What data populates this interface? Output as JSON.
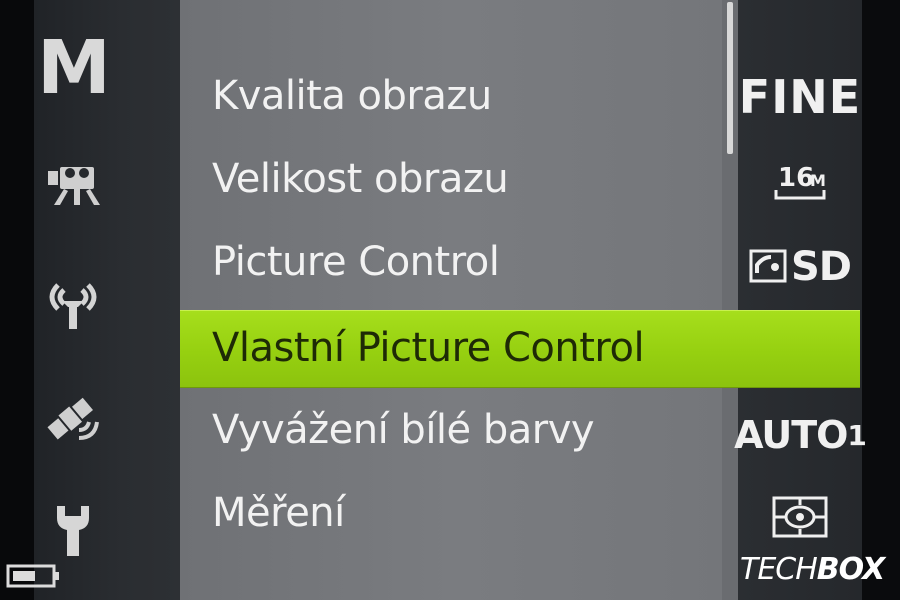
{
  "sidebar": {
    "mode_letter": "M",
    "icons": [
      "movie-camera-icon",
      "wifi-icon",
      "gps-satellite-icon",
      "wrench-icon",
      "battery-icon"
    ]
  },
  "menu": {
    "items": [
      {
        "label": "Kvalita obrazu",
        "value": "FINE"
      },
      {
        "label": "Velikost obrazu",
        "value": "16M"
      },
      {
        "label": "Picture Control",
        "value": "SD"
      },
      {
        "label": "Vlastní Picture Control",
        "value": ""
      },
      {
        "label": "Vyvážení bílé barvy",
        "value": "AUTO",
        "value_sub": "1"
      },
      {
        "label": "Měření",
        "value": "metering-icon"
      }
    ],
    "selected_index": 3
  },
  "values": {
    "size_text": "16",
    "size_unit": "M"
  },
  "colors": {
    "highlight": "#9ed614",
    "sidebar": "#2a2d31",
    "menu_bg": "#77797d",
    "text": "#f2f2f2"
  },
  "watermark": {
    "part1": "TECH",
    "part2": "BOX"
  }
}
